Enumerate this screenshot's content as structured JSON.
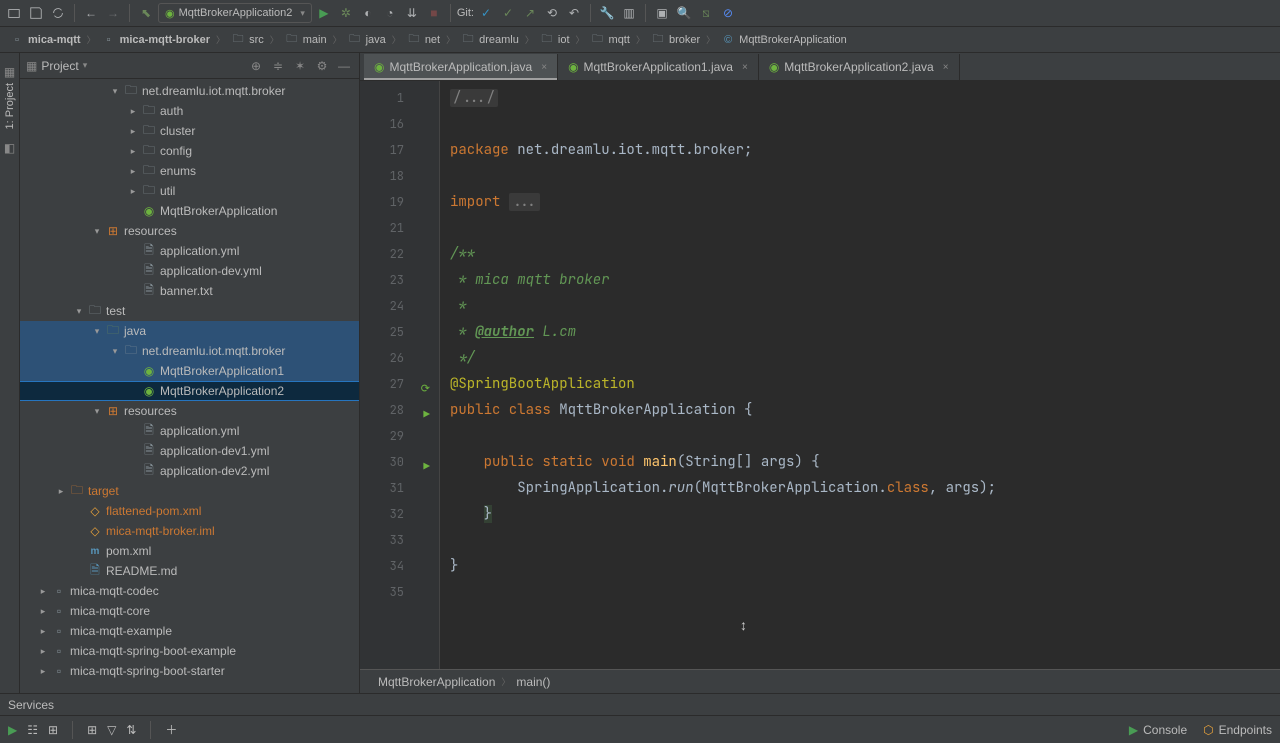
{
  "toolbar": {
    "run_config": "MqttBrokerApplication2",
    "git_label": "Git:"
  },
  "breadcrumb": [
    "mica-mqtt",
    "mica-mqtt-broker",
    "src",
    "main",
    "java",
    "net",
    "dreamlu",
    "iot",
    "mqtt",
    "broker",
    "MqttBrokerApplication"
  ],
  "sidebar": {
    "title": "Project",
    "vertical_tab": "1: Project",
    "tree": [
      {
        "d": 5,
        "a": "▾",
        "i": "folder",
        "t": "net.dreamlu.iot.mqtt.broker"
      },
      {
        "d": 6,
        "a": "▸",
        "i": "folder",
        "t": "auth"
      },
      {
        "d": 6,
        "a": "▸",
        "i": "folder",
        "t": "cluster"
      },
      {
        "d": 6,
        "a": "▸",
        "i": "folder",
        "t": "config"
      },
      {
        "d": 6,
        "a": "▸",
        "i": "folder",
        "t": "enums"
      },
      {
        "d": 6,
        "a": "▸",
        "i": "folder",
        "t": "util"
      },
      {
        "d": 6,
        "a": "",
        "i": "spring",
        "t": "MqttBrokerApplication"
      },
      {
        "d": 4,
        "a": "▾",
        "i": "res",
        "t": "resources"
      },
      {
        "d": 6,
        "a": "",
        "i": "file",
        "t": "application.yml"
      },
      {
        "d": 6,
        "a": "",
        "i": "file",
        "t": "application-dev.yml"
      },
      {
        "d": 6,
        "a": "",
        "i": "file",
        "t": "banner.txt"
      },
      {
        "d": 3,
        "a": "▾",
        "i": "folder-o",
        "t": "test"
      },
      {
        "d": 4,
        "a": "▾",
        "i": "folder-src",
        "t": "java",
        "sel": "multi"
      },
      {
        "d": 5,
        "a": "▾",
        "i": "folder",
        "t": "net.dreamlu.iot.mqtt.broker",
        "sel": "multi"
      },
      {
        "d": 6,
        "a": "",
        "i": "spring",
        "t": "MqttBrokerApplication1",
        "sel": "multi"
      },
      {
        "d": 6,
        "a": "",
        "i": "spring",
        "t": "MqttBrokerApplication2",
        "sel": "active"
      },
      {
        "d": 4,
        "a": "▾",
        "i": "res",
        "t": "resources"
      },
      {
        "d": 6,
        "a": "",
        "i": "file",
        "t": "application.yml"
      },
      {
        "d": 6,
        "a": "",
        "i": "file",
        "t": "application-dev1.yml"
      },
      {
        "d": 6,
        "a": "",
        "i": "file",
        "t": "application-dev2.yml"
      },
      {
        "d": 2,
        "a": "▸",
        "i": "folder-ex",
        "t": "target",
        "cls": "orange"
      },
      {
        "d": 3,
        "a": "",
        "i": "xml",
        "t": "flattened-pom.xml",
        "cls": "orange"
      },
      {
        "d": 3,
        "a": "",
        "i": "xml",
        "t": "mica-mqtt-broker.iml",
        "cls": "orange"
      },
      {
        "d": 3,
        "a": "",
        "i": "mvn",
        "t": "pom.xml"
      },
      {
        "d": 3,
        "a": "",
        "i": "md",
        "t": "README.md"
      },
      {
        "d": 1,
        "a": "▸",
        "i": "mod",
        "t": "mica-mqtt-codec"
      },
      {
        "d": 1,
        "a": "▸",
        "i": "mod",
        "t": "mica-mqtt-core"
      },
      {
        "d": 1,
        "a": "▸",
        "i": "mod",
        "t": "mica-mqtt-example"
      },
      {
        "d": 1,
        "a": "▸",
        "i": "mod",
        "t": "mica-mqtt-spring-boot-example"
      },
      {
        "d": 1,
        "a": "▸",
        "i": "mod",
        "t": "mica-mqtt-spring-boot-starter"
      }
    ]
  },
  "tabs": [
    {
      "label": "MqttBrokerApplication.java",
      "active": true
    },
    {
      "label": "MqttBrokerApplication1.java",
      "active": false
    },
    {
      "label": "MqttBrokerApplication2.java",
      "active": false
    }
  ],
  "code": {
    "start_line": 1,
    "lines": [
      {
        "n": 1,
        "html": "<span class='c-fold'>/.../</span>"
      },
      {
        "n": 16,
        "html": ""
      },
      {
        "n": 17,
        "html": "<span class='c-kw'>package</span> <span class='c-id'>net.dreamlu.iot.mqtt.broker;</span>"
      },
      {
        "n": 18,
        "html": ""
      },
      {
        "n": 19,
        "html": "<span class='c-kw'>import</span> <span class='c-fold'>...</span>"
      },
      {
        "n": 21,
        "html": ""
      },
      {
        "n": 22,
        "html": "<span class='c-doc'>/**</span>"
      },
      {
        "n": 23,
        "html": "<span class='c-doc'> * mica mqtt broker</span>"
      },
      {
        "n": 24,
        "html": "<span class='c-doc'> *</span>"
      },
      {
        "n": 25,
        "html": "<span class='c-doc'> * </span><span class='c-tag'>@author</span><span class='c-doc'> L.cm</span>"
      },
      {
        "n": 26,
        "html": "<span class='c-doc'> */</span>"
      },
      {
        "n": 27,
        "html": "<span class='c-ann'>@SpringBootApplication</span>",
        "gi": "⟳"
      },
      {
        "n": 28,
        "html": "<span class='c-kw'>public class</span> <span class='c-id'>MqttBrokerApplication {</span>",
        "gi": "▶"
      },
      {
        "n": 29,
        "html": ""
      },
      {
        "n": 30,
        "html": "    <span class='c-kw'>public static void</span> <span class='c-mtd'>main</span><span class='c-id'>(String[] args) {</span>",
        "gi": "▶"
      },
      {
        "n": 31,
        "html": "        <span class='c-id'>SpringApplication.</span><span class='c-id' style='font-style:italic'>run</span><span class='c-id'>(MqttBrokerApplication.</span><span class='c-kw'>class</span><span class='c-id'>, args);</span>"
      },
      {
        "n": 32,
        "html": "    <span class='c-id' style='background:#344134'>}</span>"
      },
      {
        "n": 33,
        "html": ""
      },
      {
        "n": 34,
        "html": "<span class='c-id'>}</span>"
      },
      {
        "n": 35,
        "html": ""
      }
    ]
  },
  "editor_crumb": [
    "MqttBrokerApplication",
    "main()"
  ],
  "status": {
    "label": "Services"
  },
  "bottom": {
    "console": "Console",
    "endpoints": "Endpoints"
  }
}
